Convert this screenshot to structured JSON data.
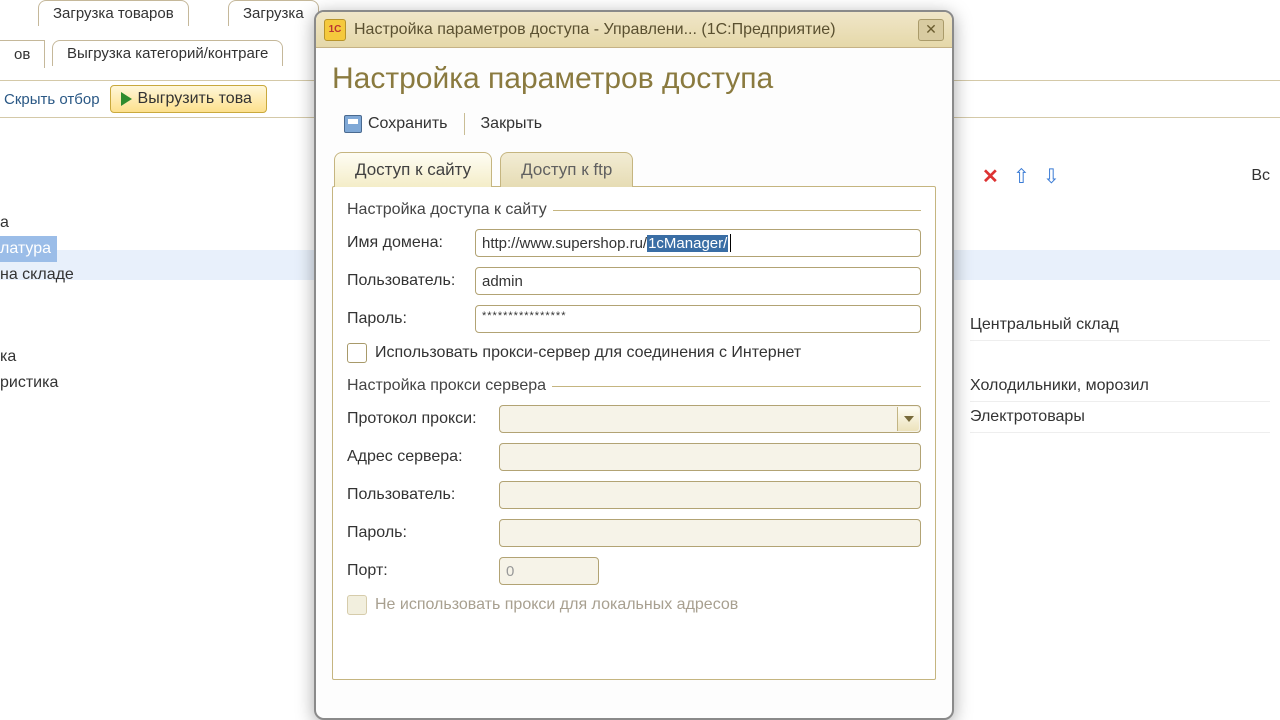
{
  "bg": {
    "tab1": "Загрузка товаров",
    "tab2": "Загрузка",
    "subtab1": "ов",
    "subtab2": "Выгрузка категорий/контраге",
    "hide_filter": "Скрыть отбор",
    "export_btn": "Выгрузить това",
    "vs_label": "Вс",
    "tree": {
      "i0": "а",
      "i1": "латура",
      "i2": "на складе",
      "i3": "",
      "i4": "ка",
      "i5": "ристика"
    },
    "right": {
      "r1": "Центральный склад",
      "r2": "Холодильники, морозил",
      "r3": "Электротовары"
    }
  },
  "dialog": {
    "title": "Настройка параметров доступа - Управлени...  (1С:Предприятие)",
    "heading": "Настройка параметров доступа",
    "toolbar": {
      "save": "Сохранить",
      "close": "Закрыть"
    },
    "tabs": {
      "site": "Доступ к сайту",
      "ftp": "Доступ к ftp"
    },
    "site_group": "Настройка доступа к сайту",
    "domain_label": "Имя домена:",
    "domain_prefix": "http://www.supershop.ru/",
    "domain_selected": "1cManager/",
    "user_label": "Пользователь:",
    "user_value": "admin",
    "pass_label": "Пароль:",
    "pass_value": "****************",
    "proxy_check": "Использовать прокси-сервер для соединения с Интернет",
    "proxy_group": "Настройка прокси сервера",
    "proto_label": "Протокол прокси:",
    "addr_label": "Адрес сервера:",
    "puser_label": "Пользователь:",
    "ppass_label": "Пароль:",
    "port_label": "Порт:",
    "port_value": "0",
    "local_check": "Не использовать прокси для локальных адресов"
  }
}
